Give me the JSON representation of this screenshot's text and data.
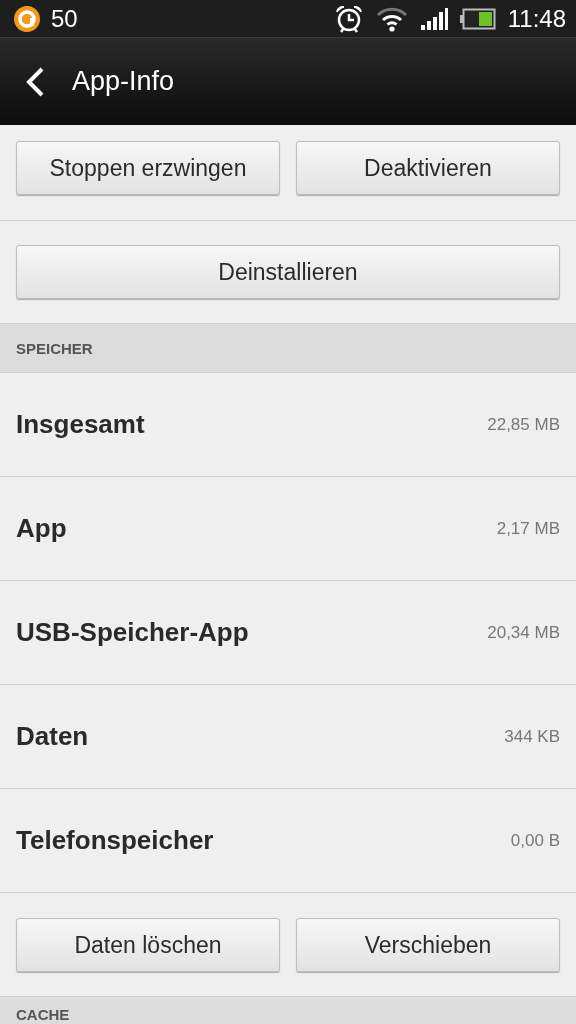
{
  "status_bar": {
    "notification_count": "50",
    "time": "11:48"
  },
  "action_bar": {
    "title": "App-Info"
  },
  "top_buttons": [
    {
      "label": "Stoppen erzwingen",
      "disabled": false
    },
    {
      "label": "Deaktivieren",
      "disabled": false
    }
  ],
  "uninstall_button": {
    "label": "Deinstallieren",
    "disabled": false
  },
  "storage_section": {
    "header": "SPEICHER",
    "rows": [
      {
        "label": "Insgesamt",
        "value": "22,85 MB"
      },
      {
        "label": "App",
        "value": "2,17 MB"
      },
      {
        "label": "USB-Speicher-App",
        "value": "20,34 MB"
      },
      {
        "label": "Daten",
        "value": "344 KB"
      },
      {
        "label": "Telefonspeicher",
        "value": "0,00 B"
      }
    ]
  },
  "storage_buttons": [
    {
      "label": "Daten löschen",
      "disabled": false
    },
    {
      "label": "Verschieben",
      "disabled": false
    }
  ],
  "cache_section": {
    "header": "CACHE"
  }
}
